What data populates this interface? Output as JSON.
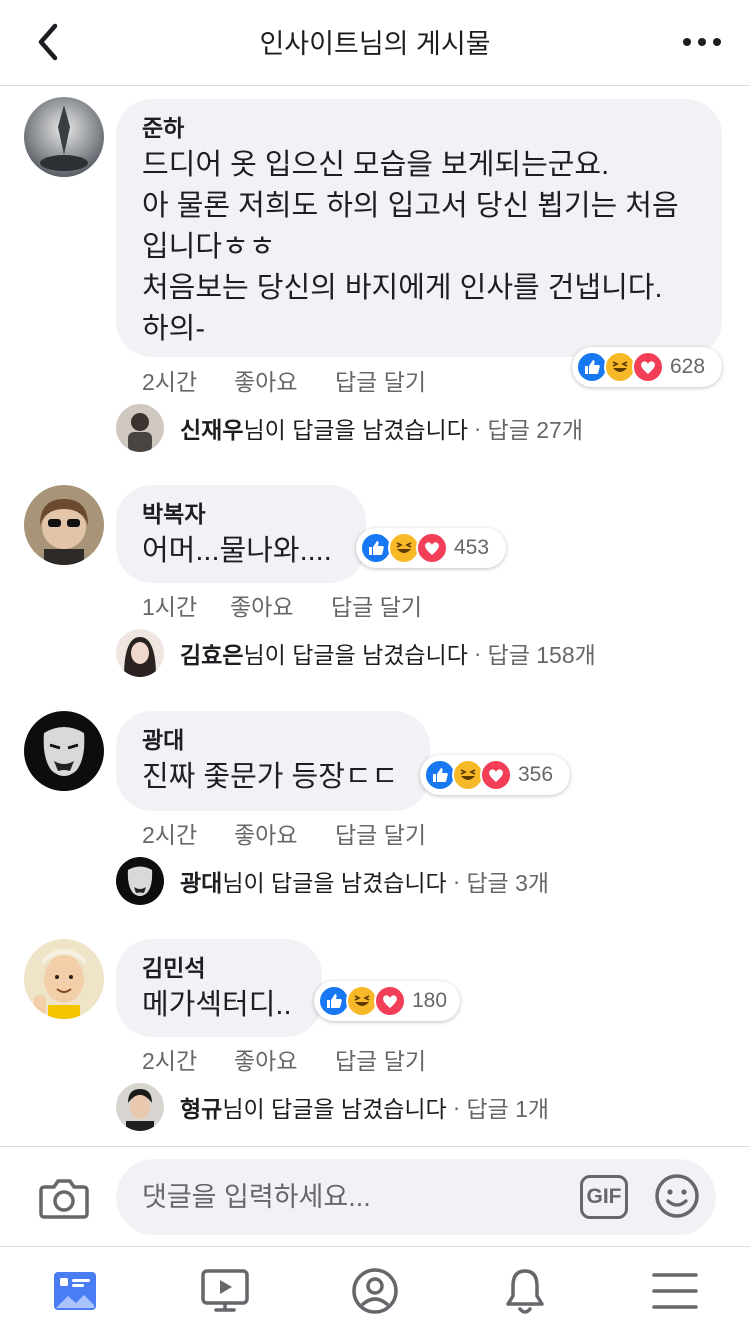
{
  "header": {
    "title": "인사이트님의 게시물"
  },
  "comments": [
    {
      "author": "준하",
      "text": "드디어 옷 입으신 모습을 보게되는군요.\n아 물론 저희도 하의 입고서 당신 뵙기는 처음\n입니다ㅎㅎ\n처음보는 당신의 바지에게 인사를 건냅니다.\n하의-",
      "reaction_count": "628",
      "time": "2시간",
      "like_label": "좋아요",
      "reply_label": "답글 달기",
      "reply_author": "신재우",
      "reply_suffix": "님이 답글을 남겼습니다",
      "reply_count": "답글 27개"
    },
    {
      "author": "박복자",
      "text": "어머...물나와....",
      "reaction_count": "453",
      "time": "1시간",
      "like_label": "좋아요",
      "reply_label": "답글 달기",
      "reply_author": "김효은",
      "reply_suffix": "님이 답글을 남겼습니다",
      "reply_count": "답글 158개"
    },
    {
      "author": "광대",
      "text": "진짜 좇문가 등장ㄷㄷ",
      "reaction_count": "356",
      "time": "2시간",
      "like_label": "좋아요",
      "reply_label": "답글 달기",
      "reply_author": "광대",
      "reply_suffix": "님이 답글을 남겼습니다",
      "reply_count": "답글 3개"
    },
    {
      "author": "김민석",
      "text": "메가섹터디..",
      "reaction_count": "180",
      "time": "2시간",
      "like_label": "좋아요",
      "reply_label": "답글 달기",
      "reply_author": "형규",
      "reply_suffix": "님이 답글을 남겼습니다",
      "reply_count": "답글 1개"
    }
  ],
  "input": {
    "placeholder": "댓글을 입력하세요...",
    "gif_label": "GIF"
  },
  "separator": "·",
  "colors": {
    "accent": "#4a7cf4",
    "like": "#1877f2",
    "haha": "#f7b928",
    "love": "#f33e58",
    "bubble": "#f0f2f5",
    "muted": "#65676b"
  },
  "icons": [
    "back-arrow-icon",
    "more-dots-icon",
    "camera-icon",
    "gif-icon",
    "emoji-icon",
    "news-feed-icon",
    "watch-icon",
    "profile-icon",
    "bell-icon",
    "menu-icon",
    "like-reaction-icon",
    "haha-reaction-icon",
    "love-reaction-icon"
  ]
}
